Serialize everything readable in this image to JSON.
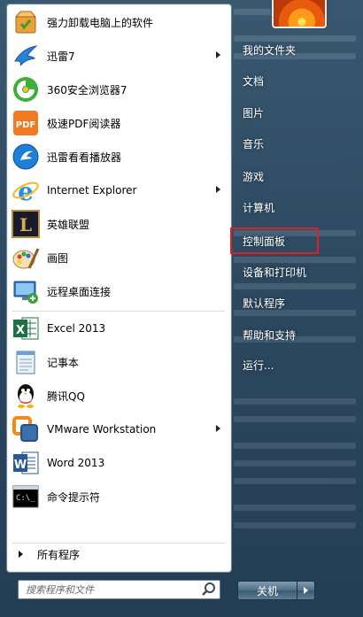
{
  "programs": [
    {
      "label": "强力卸载电脑上的软件",
      "icon": "uninstall-icon",
      "arrow": false
    },
    {
      "label": "迅雷7",
      "icon": "thunder-icon",
      "arrow": true
    },
    {
      "label": "360安全浏览器7",
      "icon": "browser-360-icon",
      "arrow": false
    },
    {
      "label": "极速PDF阅读器",
      "icon": "pdf-icon",
      "arrow": false
    },
    {
      "label": "迅雷看看播放器",
      "icon": "player-icon",
      "arrow": false
    },
    {
      "label": "Internet Explorer",
      "icon": "ie-icon",
      "arrow": true
    },
    {
      "label": "英雄联盟",
      "icon": "lol-icon",
      "arrow": false
    },
    {
      "label": "画图",
      "icon": "paint-icon",
      "arrow": false
    },
    {
      "label": "远程桌面连接",
      "icon": "remote-desktop-icon",
      "arrow": false
    },
    {
      "label": "Excel 2013",
      "icon": "excel-icon",
      "arrow": false
    },
    {
      "label": "记事本",
      "icon": "notepad-icon",
      "arrow": false
    },
    {
      "label": "腾讯QQ",
      "icon": "qq-icon",
      "arrow": false
    },
    {
      "label": "VMware Workstation",
      "icon": "vmware-icon",
      "arrow": true
    },
    {
      "label": "Word 2013",
      "icon": "word-icon",
      "arrow": false
    },
    {
      "label": "命令提示符",
      "icon": "cmd-icon",
      "arrow": false
    }
  ],
  "all_programs": "所有程序",
  "search": {
    "placeholder": "搜索程序和文件"
  },
  "right_items": [
    {
      "label": "我的文件夹"
    },
    {
      "label": "文档"
    },
    {
      "label": "图片"
    },
    {
      "label": "音乐"
    },
    {
      "label": "游戏"
    },
    {
      "label": "计算机"
    },
    {
      "label": "控制面板",
      "highlighted": true
    },
    {
      "label": "设备和打印机"
    },
    {
      "label": "默认程序"
    },
    {
      "label": "帮助和支持"
    },
    {
      "label": "运行..."
    }
  ],
  "shutdown_label": "关机",
  "colors": {
    "highlight_box": "#d42424",
    "pane_bg": "#ffffff"
  }
}
